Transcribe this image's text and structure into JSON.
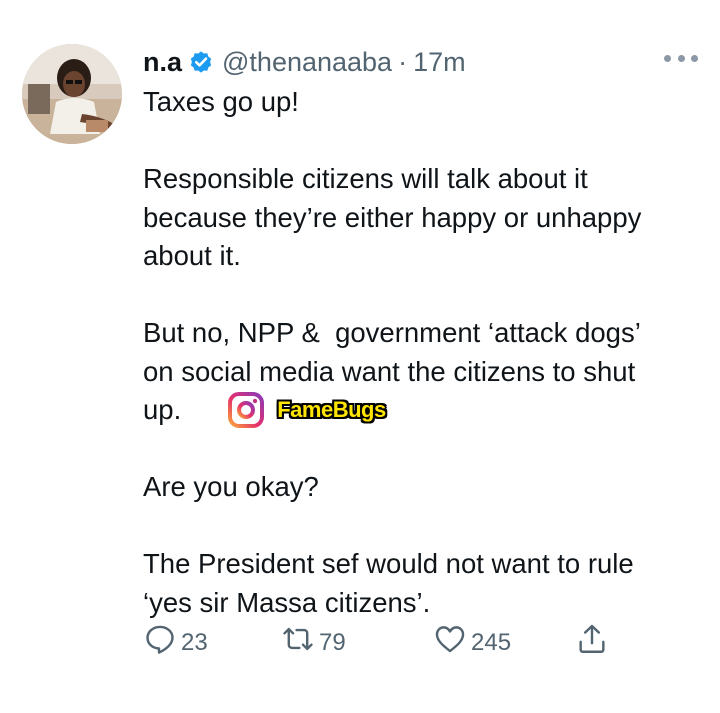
{
  "user": {
    "name": "n.a",
    "handle": "@thenanaaba",
    "separator": "·",
    "time": "17m",
    "verified": true
  },
  "tweet": {
    "paragraphs": [
      [
        "Taxes go up!"
      ],
      [
        "Responsible citizens will talk about it",
        "because they’re either happy or unhappy",
        "about it."
      ],
      [
        "But no, NPP &  government ‘attack dogs’",
        "on social media want the citizens to shut"
      ],
      [
        "up."
      ],
      [
        "Are you okay?"
      ],
      [
        "The President sef would not want to rule",
        "‘yes sir Massa citizens’."
      ]
    ]
  },
  "watermark": {
    "text": "FameBugs",
    "icon": "instagram-icon"
  },
  "actions": {
    "reply_count": "23",
    "retweet_count": "79",
    "like_count": "245"
  },
  "colors": {
    "verified": "#1d9bf0",
    "secondary_text": "#536471",
    "watermark_text": "#ffe500"
  }
}
